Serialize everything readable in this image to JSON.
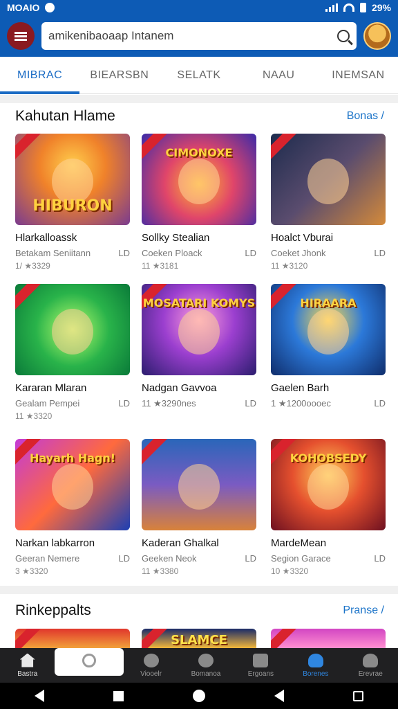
{
  "status_bar": {
    "carrier": "MOAIO",
    "battery": "29%"
  },
  "header": {
    "search_value": "amikenibaoaap Intanem"
  },
  "tabs": [
    {
      "label": "MIBRAC"
    },
    {
      "label": "BIEARSBN"
    },
    {
      "label": "SELATK"
    },
    {
      "label": "NAAU"
    },
    {
      "label": "INEMSAN"
    }
  ],
  "section1": {
    "title": "Kahutan Hlame",
    "link": "Bonas /"
  },
  "section2": {
    "title": "Rinkeppalts",
    "link": "Pranse /"
  },
  "games": [
    {
      "title": "Hlarkalloassk",
      "sub": "Betakam Seniitann",
      "badge": "LD",
      "meta": "1/ ★3329",
      "art_title": "HIBURON",
      "style": "g1"
    },
    {
      "title": "Sollky Stealian",
      "sub": "Coeken Ploack",
      "badge": "LD",
      "meta": "11 ★3181",
      "art_title": "CIMONOXE",
      "style": "g2"
    },
    {
      "title": "Hoalct Vburai",
      "sub": "Coeket Jhonk",
      "badge": "LD",
      "meta": "11 ★3120",
      "art_title": "",
      "style": "g3"
    },
    {
      "title": "Kararan Mlaran",
      "sub": "Gealam Pempei",
      "badge": "LD",
      "meta": "11 ★3320",
      "art_title": "",
      "style": "g4"
    },
    {
      "title": "Nadgan Gavvoa",
      "sub": "11 ★3290nes",
      "badge": "LD",
      "meta": "",
      "art_title": "MOSATARI KOMYS",
      "style": "g5"
    },
    {
      "title": "Gaelen Barh",
      "sub": "1 ★1200oooec",
      "badge": "LD",
      "meta": "",
      "art_title": "HIRAARA",
      "style": "g6"
    },
    {
      "title": "Narkan labkarron",
      "sub": "Geeran Nemere",
      "badge": "LD",
      "meta": "3 ★3320",
      "art_title": "Hayarh Hagn!",
      "style": "g7"
    },
    {
      "title": "Kaderan Ghalkal",
      "sub": "Geeken Neok",
      "badge": "LD",
      "meta": "11 ★3380",
      "art_title": "",
      "style": "g8"
    },
    {
      "title": "MardeMean",
      "sub": "Segion Garace",
      "badge": "LD",
      "meta": "10 ★3320",
      "art_title": "KOHOBSEDY",
      "style": "g9"
    }
  ],
  "previews": [
    {
      "art_title": "",
      "style": "p1"
    },
    {
      "art_title": "SLAMCE",
      "style": "p2"
    },
    {
      "art_title": "",
      "style": "p3"
    }
  ],
  "bottom_nav": [
    {
      "label": "Bastra",
      "icon": "home-icon"
    },
    {
      "label": "",
      "icon": "search-icon"
    },
    {
      "label": "Viooelr",
      "icon": "clock-icon"
    },
    {
      "label": "Bomanoa",
      "icon": "chat-icon"
    },
    {
      "label": "Ergoans",
      "icon": "board-icon"
    },
    {
      "label": "Borenes",
      "icon": "person-icon"
    },
    {
      "label": "Erevrae",
      "icon": "profile-icon"
    }
  ]
}
